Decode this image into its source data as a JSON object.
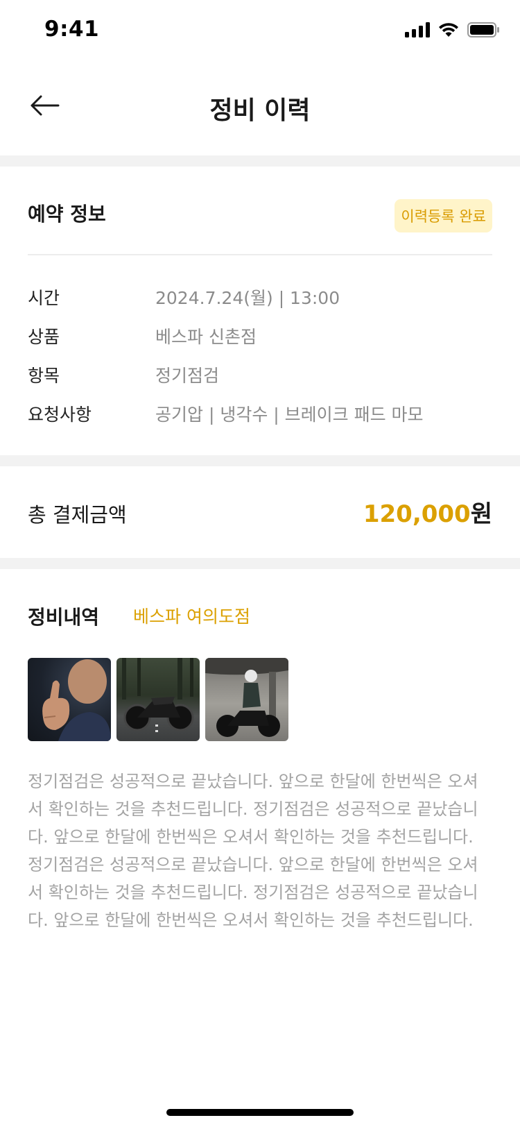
{
  "status_bar": {
    "time": "9:41",
    "icons": [
      "cellular-signal-icon",
      "wifi-icon",
      "battery-icon"
    ]
  },
  "header": {
    "back_icon": "arrow-left-icon",
    "title": "정비 이력"
  },
  "reservation": {
    "title": "예약 정보",
    "badge": "이력등록 완료",
    "rows": [
      {
        "label": "시간",
        "value": "2024.7.24(월) | 13:00"
      },
      {
        "label": "상품",
        "value": "베스파 신촌점"
      },
      {
        "label": "항목",
        "value": "정기점검"
      },
      {
        "label": "요청사항",
        "value": "공기압 | 냉각수 | 브레이크 패드 마모"
      }
    ]
  },
  "payment": {
    "label": "총 결제금액",
    "amount": "120,000",
    "unit": "원"
  },
  "maintenance": {
    "title": "정비내역",
    "shop": "베스파 여의도점",
    "photos": [
      "thumbs-up-person-photo",
      "motorcycle-forest-photo",
      "rider-under-bridge-photo"
    ],
    "description": "정기점검은 성공적으로 끝났습니다. 앞으로 한달에 한번씩은 오셔서 확인하는 것을 추천드립니다. 정기점검은 성공적으로 끝났습니다. 앞으로 한달에 한번씩은 오셔서 확인하는 것을 추천드립니다. 정기점검은 성공적으로 끝났습니다. 앞으로 한달에 한번씩은 오셔서 확인하는 것을 추천드립니다. 정기점검은 성공적으로 끝났습니다. 앞으로 한달에 한번씩은 오셔서 확인하는 것을 추천드립니다."
  },
  "colors": {
    "accent": "#dba000",
    "badge_bg": "#fff4c9",
    "divider": "#f2f2f2",
    "muted_text": "#8b8b8b"
  }
}
